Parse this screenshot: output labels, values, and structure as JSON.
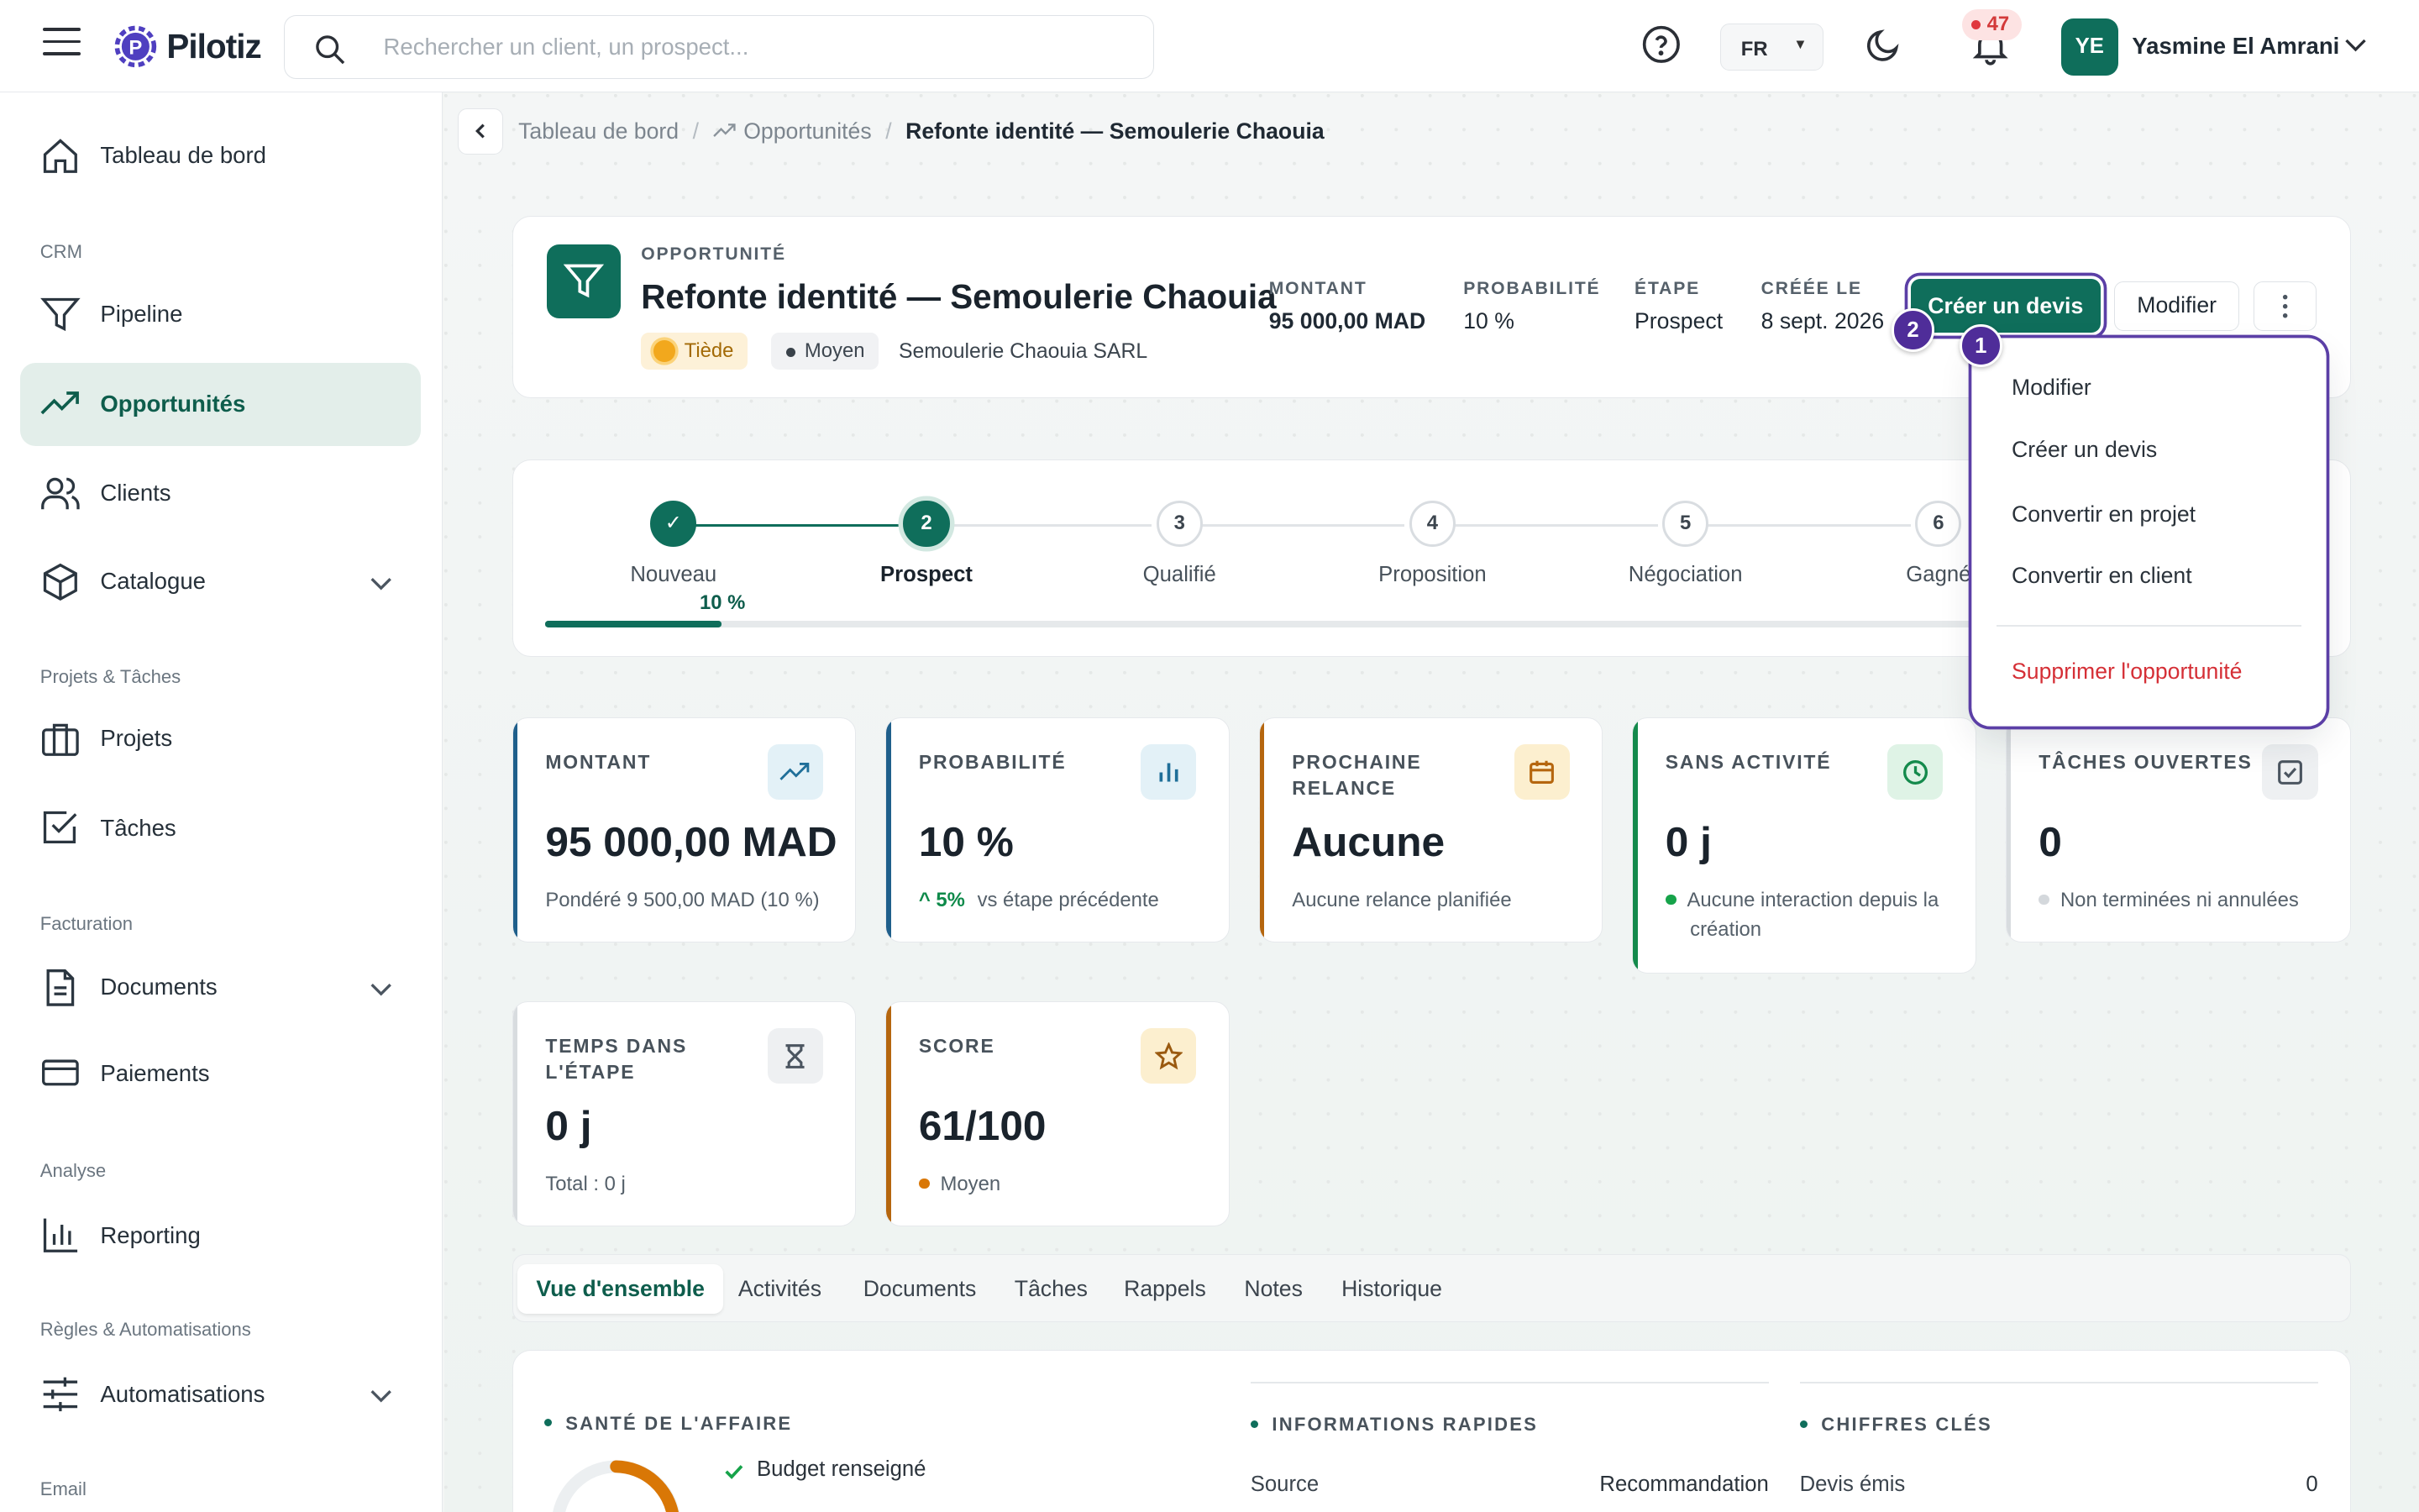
{
  "app": {
    "name": "Pilotiz"
  },
  "search": {
    "placeholder": "Rechercher un client, un prospect..."
  },
  "topbar": {
    "lang": "FR",
    "notif_count": "47",
    "user_initials": "YE",
    "user_name": "Yasmine El Amrani"
  },
  "sidebar": {
    "dashboard": "Tableau de bord",
    "sec_crm": "CRM",
    "pipeline": "Pipeline",
    "opportunities": "Opportunités",
    "clients": "Clients",
    "catalog": "Catalogue",
    "sec_projects": "Projets & Tâches",
    "projects": "Projets",
    "tasks": "Tâches",
    "sec_billing": "Facturation",
    "documents": "Documents",
    "payments": "Paiements",
    "sec_analysis": "Analyse",
    "reporting": "Reporting",
    "sec_rules": "Règles & Automatisations",
    "automations": "Automatisations",
    "sec_email": "Email"
  },
  "breadcrumb": {
    "home": "Tableau de bord",
    "list": "Opportunités",
    "current": "Refonte identité — Semoulerie Chaouia"
  },
  "header": {
    "kicker": "OPPORTUNITÉ",
    "title": "Refonte identité — Semoulerie Chaouia",
    "tag_temp": "Tiède",
    "tag_level": "Moyen",
    "company": "Semoulerie Chaouia SARL",
    "meta": [
      {
        "label": "MONTANT",
        "value": "95 000,00 MAD"
      },
      {
        "label": "PROBABILITÉ",
        "value": "10 %"
      },
      {
        "label": "ÉTAPE",
        "value": "Prospect"
      },
      {
        "label": "CRÉÉE LE",
        "value": "8 sept. 2026"
      }
    ],
    "btn_quote": "Créer un devis",
    "btn_edit": "Modifier"
  },
  "annotations": {
    "one": "1",
    "two": "2"
  },
  "menu": {
    "items": [
      "Modifier",
      "Créer un devis",
      "Convertir en projet",
      "Convertir en client"
    ],
    "danger": "Supprimer l'opportunité"
  },
  "pipeline": {
    "steps": [
      {
        "num": "✓",
        "name": "Nouveau"
      },
      {
        "num": "2",
        "name": "Prospect"
      },
      {
        "num": "3",
        "name": "Qualifié"
      },
      {
        "num": "4",
        "name": "Proposition"
      },
      {
        "num": "5",
        "name": "Négociation"
      },
      {
        "num": "6",
        "name": "Gagné"
      }
    ],
    "progress_label": "10 %",
    "progress": 0.1
  },
  "kpis": {
    "montant": {
      "label": "MONTANT",
      "value": "95 000,00 MAD",
      "sub": "Pondéré 9 500,00 MAD (10 %)"
    },
    "proba": {
      "label": "PROBABILITÉ",
      "value": "10 %",
      "delta": "^ 5%",
      "sub": "vs étape précédente"
    },
    "relance": {
      "label": "PROCHAINE RELANCE",
      "value": "Aucune",
      "sub": "Aucune relance planifiée"
    },
    "inactivite": {
      "label": "SANS ACTIVITÉ",
      "value": "0 j",
      "sub": "Aucune interaction depuis la création"
    },
    "taches": {
      "label": "TÂCHES OUVERTES",
      "value": "0",
      "sub": "Non terminées ni annulées"
    },
    "temps": {
      "label": "TEMPS DANS L'ÉTAPE",
      "value": "0 j",
      "sub": "Total : 0 j"
    },
    "score": {
      "label": "SCORE",
      "value": "61/100",
      "sub": "Moyen"
    }
  },
  "tabs": [
    "Vue d'ensemble",
    "Activités",
    "Documents",
    "Tâches",
    "Rappels",
    "Notes",
    "Historique"
  ],
  "overview": {
    "health_title": "SANTÉ DE L'AFFAIRE",
    "health_item_1": "Budget renseigné",
    "quick_title": "INFORMATIONS RAPIDES",
    "quick_source_label": "Source",
    "quick_source_value": "Recommandation",
    "keys_title": "CHIFFRES CLÉS",
    "keys_quotes_label": "Devis émis",
    "keys_quotes_value": "0"
  },
  "colors": {
    "brand": "#0f6e5b",
    "annotation": "#4f2d99",
    "danger": "#d52f36"
  }
}
